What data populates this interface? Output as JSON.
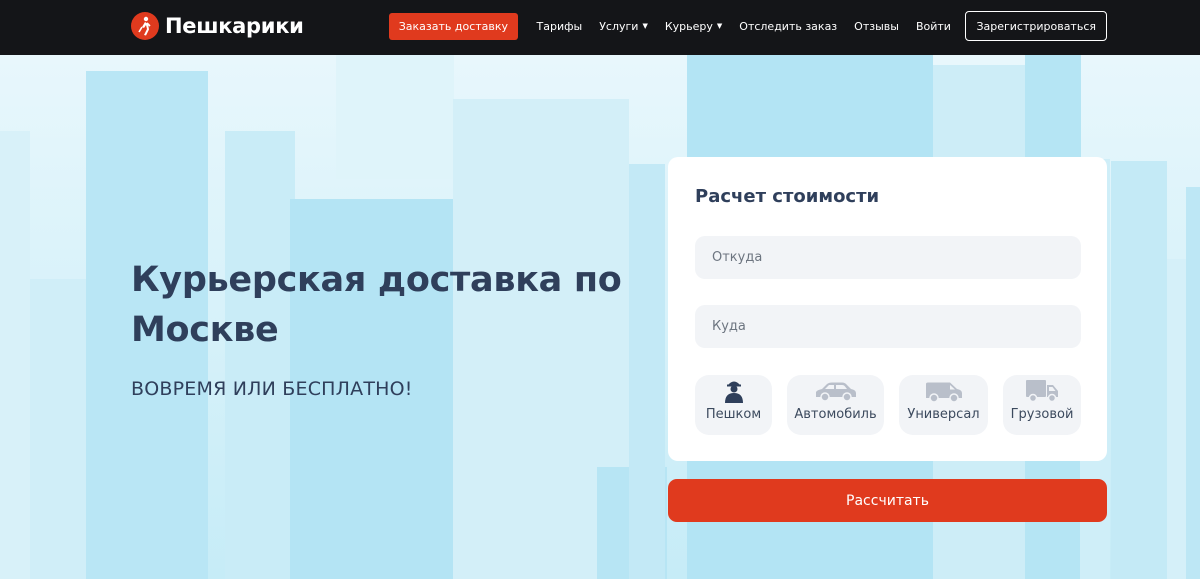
{
  "brand": {
    "name": "Пешкарики",
    "accent": "#e03a1e"
  },
  "nav": {
    "order": "Заказать доставку",
    "tariffs": "Тарифы",
    "services": "Услуги",
    "courier": "Курьеру",
    "track": "Отследить заказ",
    "reviews": "Отзывы",
    "login": "Войти",
    "register": "Зарегистрироваться"
  },
  "hero": {
    "title": "Курьерская доставка по Москве",
    "subtitle": "ВОВРЕМЯ ИЛИ БЕСПЛАТНО!"
  },
  "calculator": {
    "title": "Расчет стоимости",
    "from_placeholder": "Откуда",
    "to_placeholder": "Куда",
    "transport": [
      {
        "label": "Пешком",
        "icon": "walking-courier-icon"
      },
      {
        "label": "Автомобиль",
        "icon": "car-icon"
      },
      {
        "label": "Универсал",
        "icon": "van-icon"
      },
      {
        "label": "Грузовой",
        "icon": "truck-icon"
      }
    ],
    "submit": "Рассчитать"
  }
}
